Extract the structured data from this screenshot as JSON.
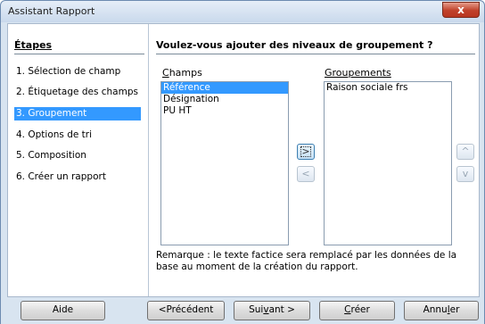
{
  "window": {
    "title": "Assistant Rapport",
    "close_label": "x"
  },
  "steps": {
    "title": "Étapes",
    "items": [
      {
        "label": "1. Sélection de champ",
        "active": false
      },
      {
        "label": "2. Étiquetage des champs",
        "active": false
      },
      {
        "label": "3. Groupement",
        "active": true
      },
      {
        "label": "4. Options de tri",
        "active": false
      },
      {
        "label": "5. Composition",
        "active": false
      },
      {
        "label": "6. Créer un rapport",
        "active": false
      }
    ]
  },
  "main": {
    "heading": "Voulez-vous ajouter des niveaux de groupement ?",
    "fields_label_underlined": "C",
    "fields_label_rest": "hamps",
    "groupings_label": "Groupements",
    "fields": [
      {
        "label": "Référence",
        "selected": true
      },
      {
        "label": "Désignation",
        "selected": false
      },
      {
        "label": "PU HT",
        "selected": false
      }
    ],
    "groupings": [
      {
        "label": "Raison sociale frs"
      }
    ],
    "add_glyph": ">",
    "remove_glyph": "<",
    "up_glyph": "^",
    "down_glyph": "v",
    "remark": "Remarque : le texte factice sera remplacé par les données de la base au moment de la création du rapport."
  },
  "buttons": {
    "help": "Aide",
    "previous": "<Précédent",
    "next_a": "Sui",
    "next_u": "v",
    "next_b": "ant >",
    "create_u": "C",
    "create_rest": "réer",
    "cancel_a": "Annu",
    "cancel_u": "l",
    "cancel_b": "er"
  }
}
